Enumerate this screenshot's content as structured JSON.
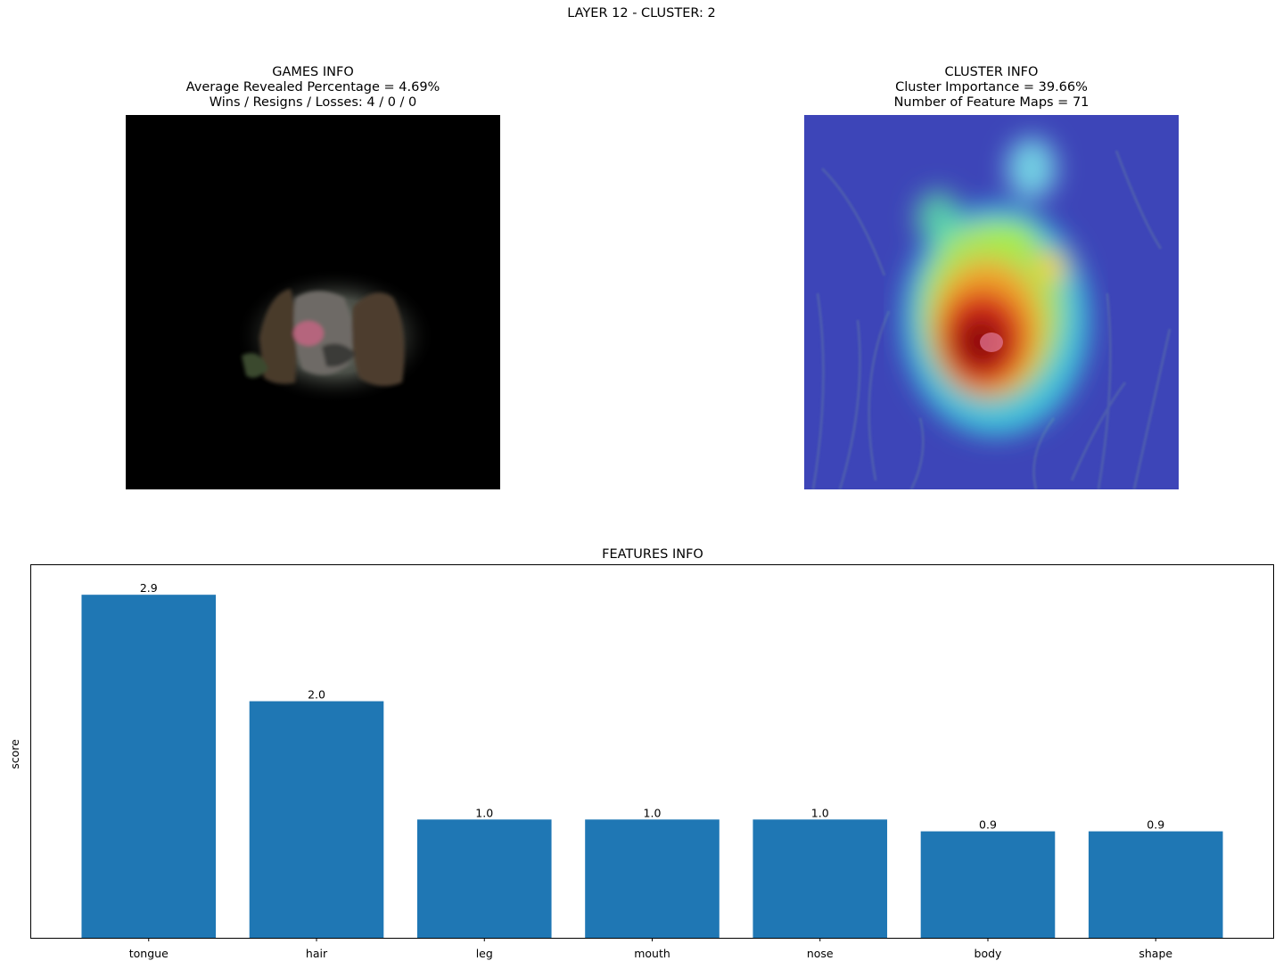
{
  "figure": {
    "suptitle": "LAYER 12 - CLUSTER: 2"
  },
  "games_info": {
    "title": "GAMES INFO",
    "line1": "Average Revealed Percentage = 4.69%",
    "line2": "Wins / Resigns / Losses: 4 / 0 / 0"
  },
  "cluster_info": {
    "title": "CLUSTER INFO",
    "line1": "Cluster Importance = 39.66%",
    "line2": "Number of Feature Maps = 71"
  },
  "chart_data": {
    "type": "bar",
    "title": "FEATURES INFO",
    "xlabel": "",
    "ylabel": "score",
    "categories": [
      "tongue",
      "hair",
      "leg",
      "mouth",
      "nose",
      "body",
      "shape"
    ],
    "values": [
      2.9,
      2.0,
      1.0,
      1.0,
      1.0,
      0.9,
      0.9
    ],
    "value_labels": [
      "2.9",
      "2.0",
      "1.0",
      "1.0",
      "1.0",
      "0.9",
      "0.9"
    ],
    "ylim": [
      0,
      3.0
    ],
    "yticks_visible": false,
    "grid": false,
    "bar_color": "#1f77b4"
  }
}
